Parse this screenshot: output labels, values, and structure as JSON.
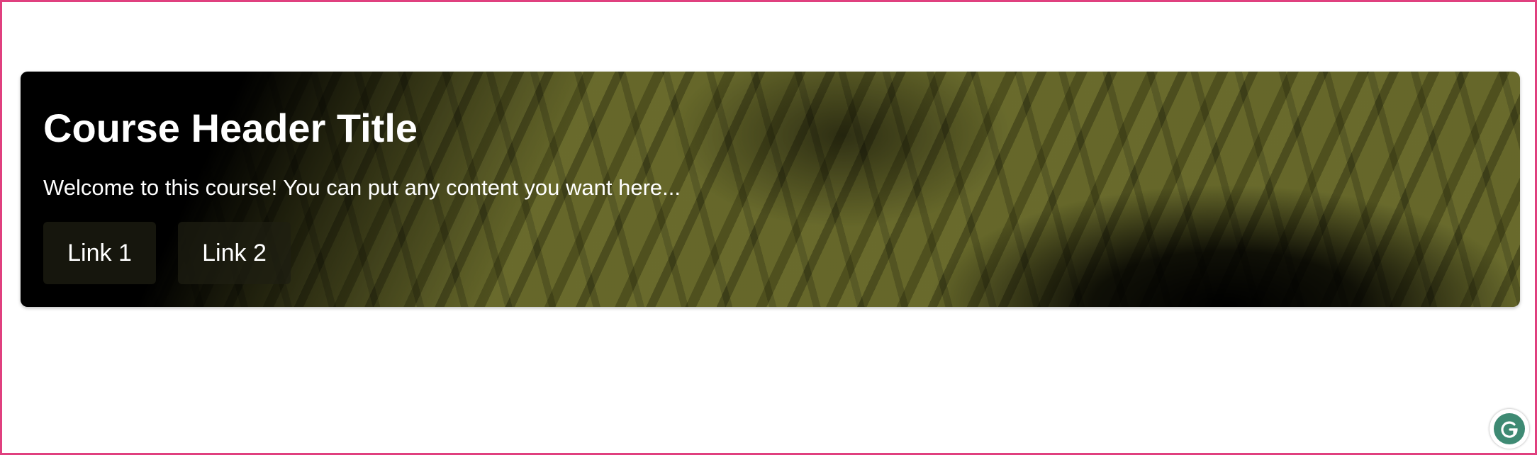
{
  "header": {
    "title": "Course Header Title",
    "subtitle": "Welcome to this course! You can put any content you want here...",
    "links": [
      {
        "label": "Link 1"
      },
      {
        "label": "Link 2"
      }
    ]
  },
  "widgets": {
    "assistant_icon": "grammarly-g-icon"
  },
  "colors": {
    "frame_border": "#e0407f",
    "banner_base": "#646629",
    "assistant_badge": "#3e8a73"
  }
}
